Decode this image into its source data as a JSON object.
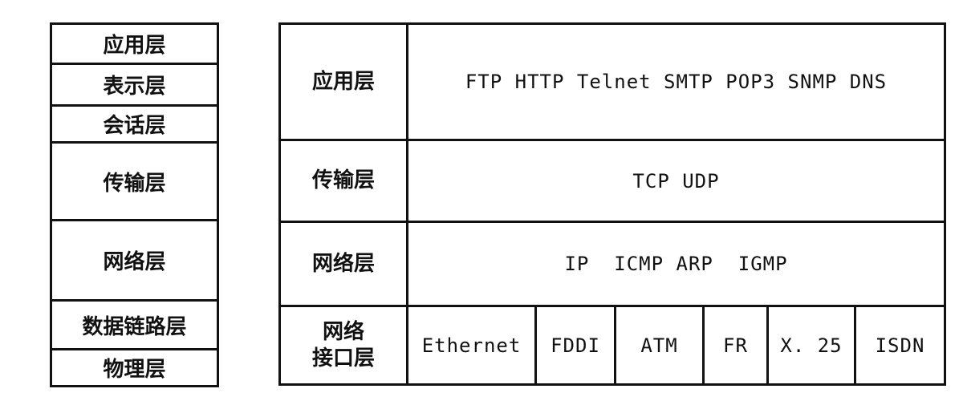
{
  "osi_model": {
    "layers": [
      {
        "name": "应用层"
      },
      {
        "name": "表示层"
      },
      {
        "name": "会话层"
      },
      {
        "name": "传输层"
      },
      {
        "name": "网络层"
      },
      {
        "name": "数据链路层"
      },
      {
        "name": "物理层"
      }
    ]
  },
  "tcpip_model": {
    "rows": [
      {
        "layer": "应用层",
        "protocols": "FTP HTTP Telnet SMTP POP3 SNMP DNS"
      },
      {
        "layer": "传输层",
        "protocols": "TCP UDP"
      },
      {
        "layer": "网络层",
        "protocols": "IP  ICMP ARP  IGMP"
      },
      {
        "layer": "网络\n接口层",
        "technologies": [
          "Ethernet",
          "FDDI",
          "ATM",
          "FR",
          "X. 25",
          "ISDN"
        ]
      }
    ]
  }
}
